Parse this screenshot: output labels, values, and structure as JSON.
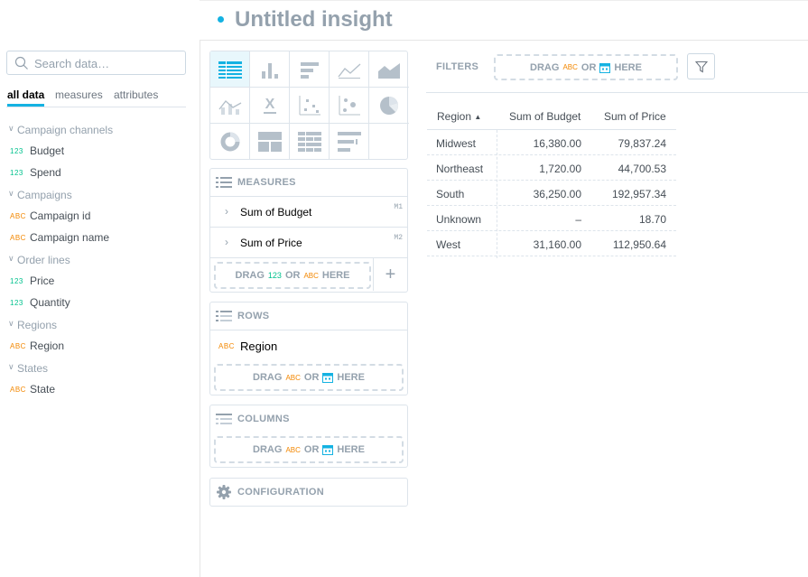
{
  "header": {
    "title": "Untitled insight"
  },
  "catalog": {
    "search_placeholder": "Search data…",
    "tabs": [
      "all data",
      "measures",
      "attributes"
    ],
    "groups": [
      {
        "label": "Campaign channels",
        "items": [
          {
            "type": "123",
            "label": "Budget"
          },
          {
            "type": "123",
            "label": "Spend"
          }
        ]
      },
      {
        "label": "Campaigns",
        "items": [
          {
            "type": "ABC",
            "label": "Campaign id"
          },
          {
            "type": "ABC",
            "label": "Campaign name"
          }
        ]
      },
      {
        "label": "Order lines",
        "items": [
          {
            "type": "123",
            "label": "Price"
          },
          {
            "type": "123",
            "label": "Quantity"
          }
        ]
      },
      {
        "label": "Regions",
        "items": [
          {
            "type": "ABC",
            "label": "Region"
          }
        ]
      },
      {
        "label": "States",
        "items": [
          {
            "type": "ABC",
            "label": "State"
          }
        ]
      }
    ]
  },
  "viz_types": [
    "table",
    "column",
    "bar",
    "line",
    "area",
    "combo",
    "headline",
    "scatter",
    "bubble",
    "pie",
    "donut",
    "treemap",
    "heatmap",
    "bullet",
    ""
  ],
  "buckets": {
    "measures": {
      "title": "MEASURES",
      "items": [
        {
          "label": "Sum of Budget",
          "marker": "M1"
        },
        {
          "label": "Sum of Price",
          "marker": "M2"
        }
      ],
      "drop": {
        "drag": "DRAG",
        "num": "123",
        "or": "OR",
        "abc": "ABC",
        "here": "HERE"
      }
    },
    "rows": {
      "title": "ROWS",
      "item": {
        "type": "ABC",
        "label": "Region"
      },
      "drop": {
        "drag": "DRAG",
        "abc": "ABC",
        "or": "OR",
        "here": "HERE"
      }
    },
    "columns": {
      "title": "COLUMNS",
      "drop": {
        "drag": "DRAG",
        "abc": "ABC",
        "or": "OR",
        "here": "HERE"
      }
    },
    "configuration": {
      "title": "CONFIGURATION"
    }
  },
  "filters": {
    "label": "FILTERS",
    "drop": {
      "drag": "DRAG",
      "abc": "ABC",
      "or": "OR",
      "here": "HERE"
    }
  },
  "table": {
    "headers": [
      "Region",
      "Sum of Budget",
      "Sum of Price"
    ],
    "rows": [
      [
        "Midwest",
        "16,380.00",
        "79,837.24"
      ],
      [
        "Northeast",
        "1,720.00",
        "44,700.53"
      ],
      [
        "South",
        "36,250.00",
        "192,957.34"
      ],
      [
        "Unknown",
        "–",
        "18.70"
      ],
      [
        "West",
        "31,160.00",
        "112,950.64"
      ]
    ]
  },
  "colors": {
    "accent": "#14b2e2",
    "number": "#00c18d",
    "attribute": "#f38700",
    "muted": "#94a1ad"
  }
}
